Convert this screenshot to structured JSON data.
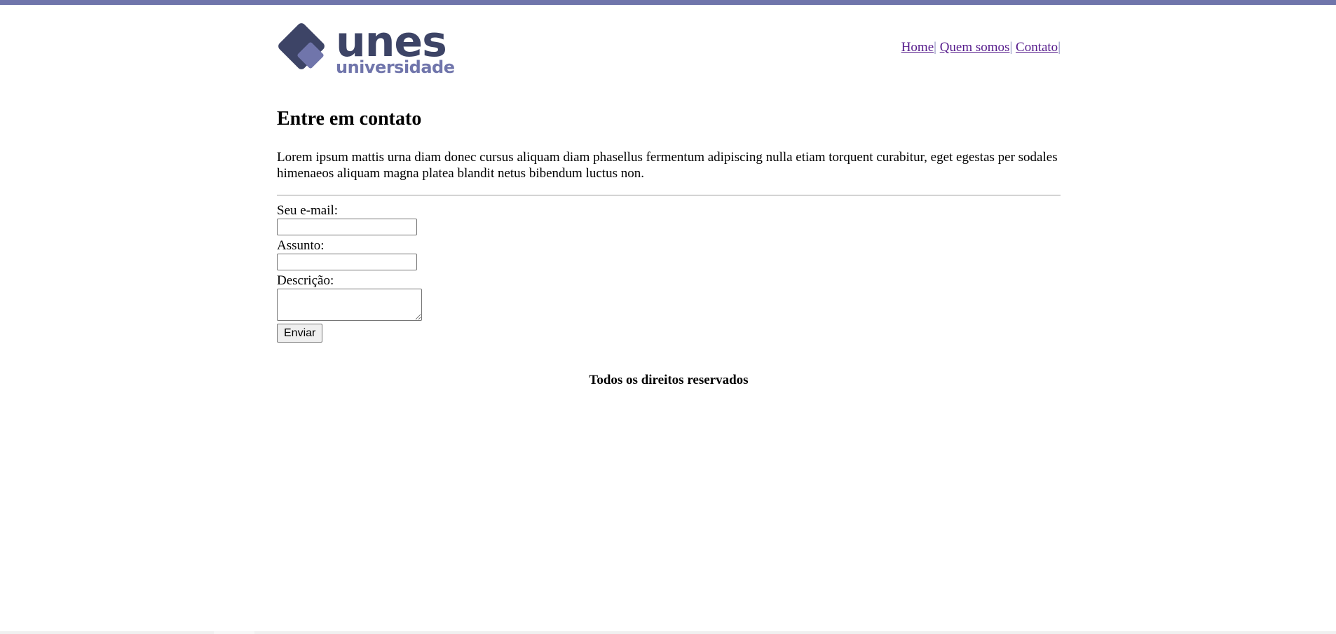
{
  "logo": {
    "brand": "unes",
    "subtitle": "universidade",
    "colors": {
      "dark": "#3d4466",
      "accent": "#7075ab"
    }
  },
  "nav": {
    "items": [
      {
        "label": "Home"
      },
      {
        "label": "Quem somos"
      },
      {
        "label": "Contato"
      }
    ],
    "separator": "|"
  },
  "main": {
    "title": "Entre em contato",
    "intro": "Lorem ipsum mattis urna diam donec cursus aliquam diam phasellus fermentum adipiscing nulla etiam torquent curabitur, eget egestas per sodales himenaeos aliquam magna platea blandit netus bibendum luctus non."
  },
  "form": {
    "email_label": "Seu e-mail:",
    "email_value": "",
    "subject_label": "Assunto:",
    "subject_value": "",
    "description_label": "Descrição:",
    "description_value": "",
    "submit_label": "Enviar"
  },
  "footer": {
    "text": "Todos os direitos reservados"
  },
  "colors": {
    "top_bar": "#7075ab",
    "link": "#551a8b"
  }
}
